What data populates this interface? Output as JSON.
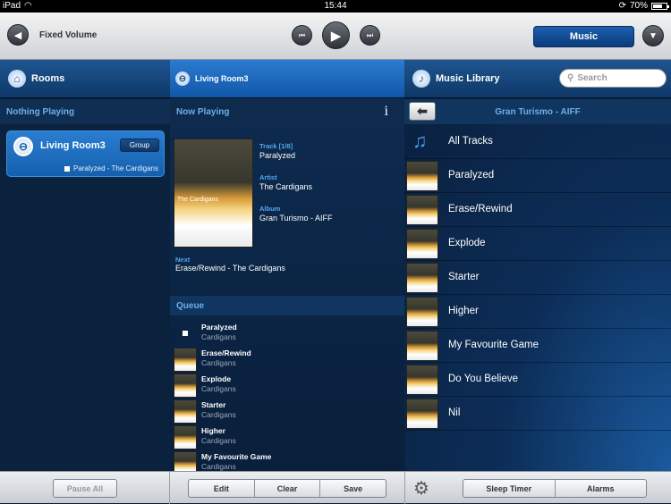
{
  "status": {
    "device": "iPad",
    "time": "15:44",
    "battery": "70%"
  },
  "toolbar": {
    "volume_label": "Fixed Volume",
    "music_label": "Music"
  },
  "rooms": {
    "title": "Rooms",
    "nothing_playing": "Nothing Playing",
    "room_name": "Living Room3",
    "group_label": "Group",
    "now_playing": "Paralyzed - The Cardigans"
  },
  "now_playing": {
    "room": "Living Room3",
    "header": "Now Playing",
    "info_label": "i",
    "track_label": "Track [1/8]",
    "track": "Paralyzed",
    "artist_label": "Artist",
    "artist": "The Cardigans",
    "album_label": "Album",
    "album": "Gran Turismo - AIFF",
    "next_label": "Next",
    "next": "Erase/Rewind - The Cardigans",
    "album_art_text": "The Cardigans"
  },
  "queue": {
    "header": "Queue",
    "items": [
      {
        "title": "Paralyzed",
        "artist": "Cardigans"
      },
      {
        "title": "Erase/Rewind",
        "artist": "Cardigans"
      },
      {
        "title": "Explode",
        "artist": "Cardigans"
      },
      {
        "title": "Starter",
        "artist": "Cardigans"
      },
      {
        "title": "Higher",
        "artist": "Cardigans"
      },
      {
        "title": "My Favourite Game",
        "artist": "Cardigans"
      }
    ]
  },
  "library": {
    "title": "Music Library",
    "search_placeholder": "Search",
    "album": "Gran Turismo - AIFF",
    "items": [
      "All Tracks",
      "Paralyzed",
      "Erase/Rewind",
      "Explode",
      "Starter",
      "Higher",
      "My Favourite Game",
      "Do You Believe",
      "Nil"
    ]
  },
  "bottom": {
    "pause_all": "Pause All",
    "edit": "Edit",
    "clear": "Clear",
    "save": "Save",
    "sleep_timer": "Sleep Timer",
    "alarms": "Alarms"
  }
}
